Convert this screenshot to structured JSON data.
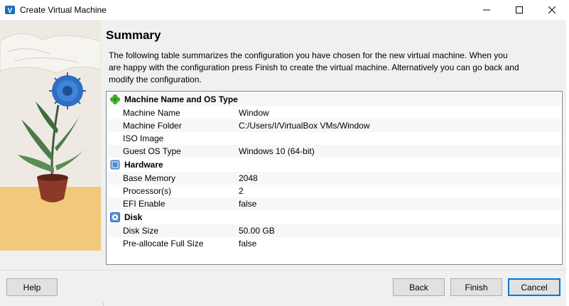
{
  "window": {
    "title": "Create Virtual Machine"
  },
  "page": {
    "heading": "Summary",
    "description": "The following table summarizes the configuration you have chosen for the new virtual machine. When you are happy with the configuration press Finish to create the virtual machine. Alternatively you can go back and modify the configuration."
  },
  "summary": {
    "sections": [
      {
        "title": "Machine Name and OS Type",
        "icon": "clover-icon",
        "rows": [
          {
            "key": "Machine Name",
            "value": "Window"
          },
          {
            "key": "Machine Folder",
            "value": "C:/Users/I/VirtualBox VMs/Window"
          },
          {
            "key": "ISO Image",
            "value": ""
          },
          {
            "key": "Guest OS Type",
            "value": "Windows 10 (64-bit)"
          }
        ]
      },
      {
        "title": "Hardware",
        "icon": "chip-icon",
        "rows": [
          {
            "key": "Base Memory",
            "value": "2048"
          },
          {
            "key": "Processor(s)",
            "value": "2"
          },
          {
            "key": "EFI Enable",
            "value": "false"
          }
        ]
      },
      {
        "title": "Disk",
        "icon": "disk-icon",
        "rows": [
          {
            "key": "Disk Size",
            "value": "50.00 GB"
          },
          {
            "key": "Pre-allocate Full Size",
            "value": "false"
          }
        ]
      }
    ]
  },
  "buttons": {
    "help": "Help",
    "back": "Back",
    "finish": "Finish",
    "cancel": "Cancel"
  },
  "colors": {
    "accent": "#0078d7",
    "window_bg": "#f0f0f0"
  }
}
